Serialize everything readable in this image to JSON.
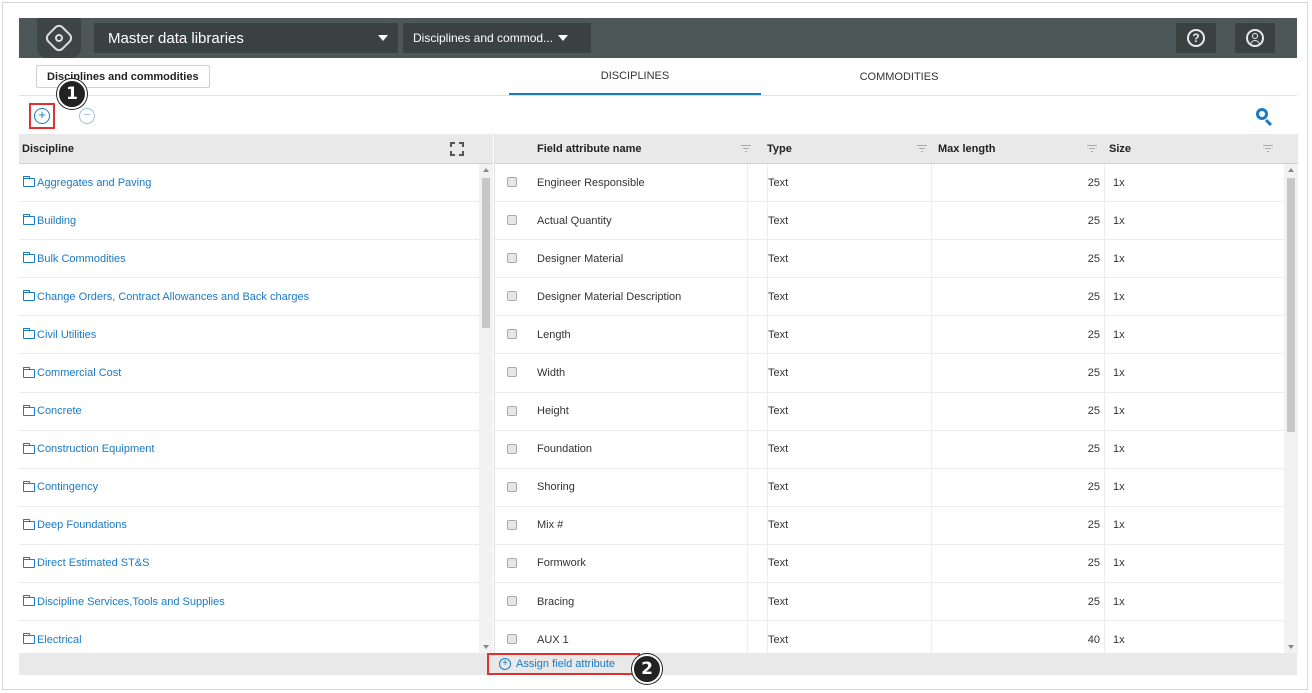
{
  "topbar": {
    "library_select": "Master data libraries",
    "view_select": "Disciplines and commod...",
    "help_icon": "question-circle-icon",
    "user_icon": "user-circle-icon",
    "logo_icon": "app-logo-icon"
  },
  "subheader": {
    "tag_label": "Disciplines and commodities",
    "tabs": [
      {
        "label": "DISCIPLINES",
        "active": true
      },
      {
        "label": "COMMODITIES",
        "active": false
      }
    ]
  },
  "toolbar": {
    "add_icon": "plus-circle-icon",
    "remove_icon": "minus-circle-icon",
    "search_icon": "search-icon"
  },
  "callouts": [
    "1",
    "2"
  ],
  "left_grid": {
    "header": "Discipline",
    "rows": [
      "Aggregates and Paving",
      "Building",
      "Bulk Commodities",
      "Change Orders, Contract Allowances and Back charges",
      "Civil Utilities",
      "Commercial Cost",
      "Concrete",
      "Construction Equipment",
      "Contingency",
      "Deep Foundations",
      "Direct Estimated ST&S",
      "Discipline Services,Tools and Supplies",
      "Electrical"
    ]
  },
  "right_grid": {
    "headers": {
      "name": "Field attribute name",
      "type": "Type",
      "max_length": "Max length",
      "size": "Size"
    },
    "rows": [
      {
        "name": "Engineer Responsible",
        "type": "Text",
        "max_length": "25",
        "size": "1x"
      },
      {
        "name": "Actual Quantity",
        "type": "Text",
        "max_length": "25",
        "size": "1x"
      },
      {
        "name": "Designer Material",
        "type": "Text",
        "max_length": "25",
        "size": "1x"
      },
      {
        "name": "Designer Material Description",
        "type": "Text",
        "max_length": "25",
        "size": "1x"
      },
      {
        "name": "Length",
        "type": "Text",
        "max_length": "25",
        "size": "1x"
      },
      {
        "name": "Width",
        "type": "Text",
        "max_length": "25",
        "size": "1x"
      },
      {
        "name": "Height",
        "type": "Text",
        "max_length": "25",
        "size": "1x"
      },
      {
        "name": "Foundation",
        "type": "Text",
        "max_length": "25",
        "size": "1x"
      },
      {
        "name": "Shoring",
        "type": "Text",
        "max_length": "25",
        "size": "1x"
      },
      {
        "name": "Mix #",
        "type": "Text",
        "max_length": "25",
        "size": "1x"
      },
      {
        "name": "Formwork",
        "type": "Text",
        "max_length": "25",
        "size": "1x"
      },
      {
        "name": "Bracing",
        "type": "Text",
        "max_length": "25",
        "size": "1x"
      },
      {
        "name": "AUX 1",
        "type": "Text",
        "max_length": "40",
        "size": "1x"
      }
    ]
  },
  "footer": {
    "assign_label": "Assign field attribute"
  },
  "colors": {
    "topbar": "#4e5757",
    "accent": "#1a7ac4",
    "highlight": "#e03030"
  }
}
